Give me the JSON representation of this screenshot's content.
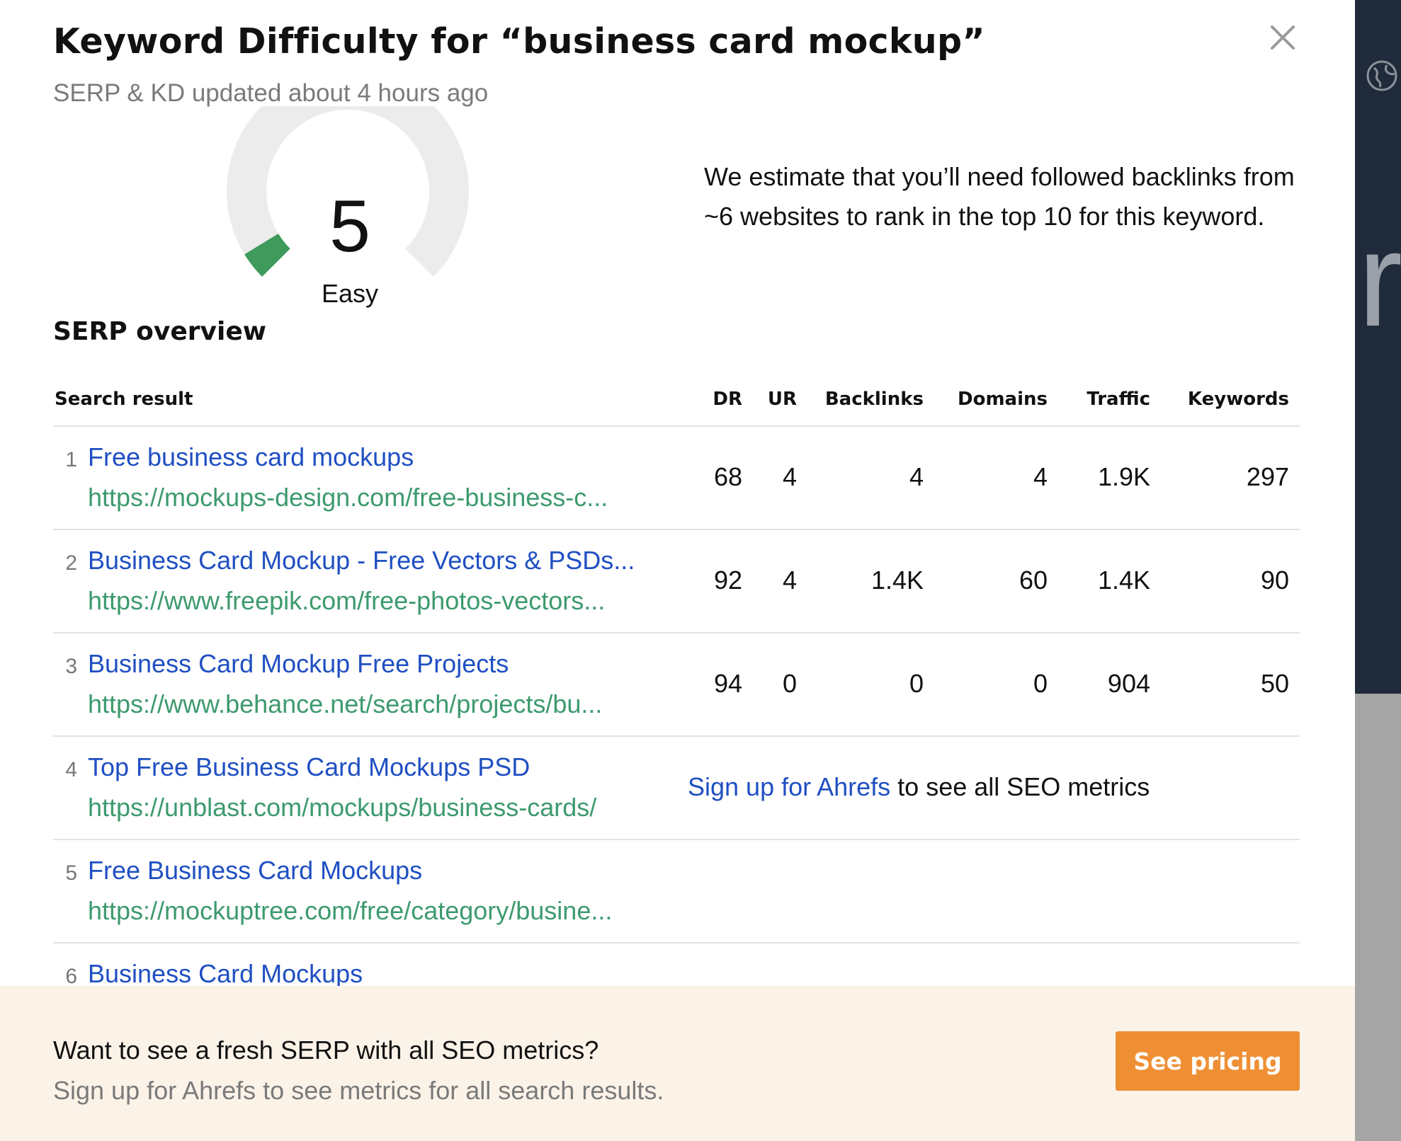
{
  "modal": {
    "title": "Keyword Difficulty for “business card mockup”",
    "subtitle": "SERP & KD updated about 4 hours ago"
  },
  "kd": {
    "value": "5",
    "label": "Easy",
    "score_fraction": 0.05,
    "fill_color": "#3f9a5b",
    "track_color": "#ececed",
    "estimate": "We estimate that you’ll need followed backlinks from ~6 websites to rank in the top 10 for this keyword."
  },
  "serp": {
    "section_title": "SERP overview",
    "columns": [
      "Search result",
      "DR",
      "UR",
      "Backlinks",
      "Domains",
      "Traffic",
      "Keywords"
    ],
    "rows": [
      {
        "rank": "1",
        "title": "Free business card mockups",
        "url": "https://mockups-design.com/free-business-c...",
        "dr": "68",
        "ur": "4",
        "backlinks": "4",
        "domains": "4",
        "traffic": "1.9K",
        "keywords": "297"
      },
      {
        "rank": "2",
        "title": "Business Card Mockup - Free Vectors & PSDs...",
        "url": "https://www.freepik.com/free-photos-vectors...",
        "dr": "92",
        "ur": "4",
        "backlinks": "1.4K",
        "domains": "60",
        "traffic": "1.4K",
        "keywords": "90"
      },
      {
        "rank": "3",
        "title": "Business Card Mockup Free Projects",
        "url": "https://www.behance.net/search/projects/bu...",
        "dr": "94",
        "ur": "0",
        "backlinks": "0",
        "domains": "0",
        "traffic": "904",
        "keywords": "50"
      },
      {
        "rank": "4",
        "title": "Top Free Business Card Mockups PSD",
        "url": "https://unblast.com/mockups/business-cards/"
      },
      {
        "rank": "5",
        "title": "Free Business Card Mockups",
        "url": "https://mockuptree.com/free/category/busine..."
      },
      {
        "rank": "6",
        "title": "Business Card Mockups",
        "url": ""
      }
    ],
    "signup_link": "Sign up for Ahrefs",
    "signup_rest": " to see all SEO metrics"
  },
  "footer": {
    "question": "Want to see a fresh SERP with all SEO metrics?",
    "subtext": "Sign up for Ahrefs to see metrics for all search results.",
    "button": "See pricing"
  },
  "backdrop": {
    "glyph": "r",
    "icon": "globe-icon"
  }
}
